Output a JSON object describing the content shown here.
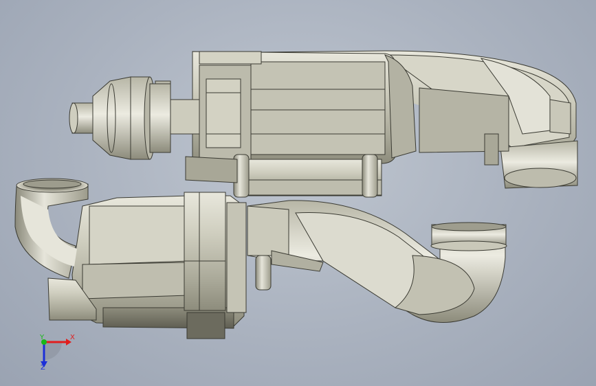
{
  "scene": {
    "background_color": "#aeb5c1",
    "model_color": "#c8c7b8"
  },
  "triad": {
    "x_label": "X",
    "y_label": "Y",
    "z_label": "Z",
    "x_color": "#e11d1d",
    "y_color": "#18b818",
    "z_color": "#1c2fd8"
  }
}
